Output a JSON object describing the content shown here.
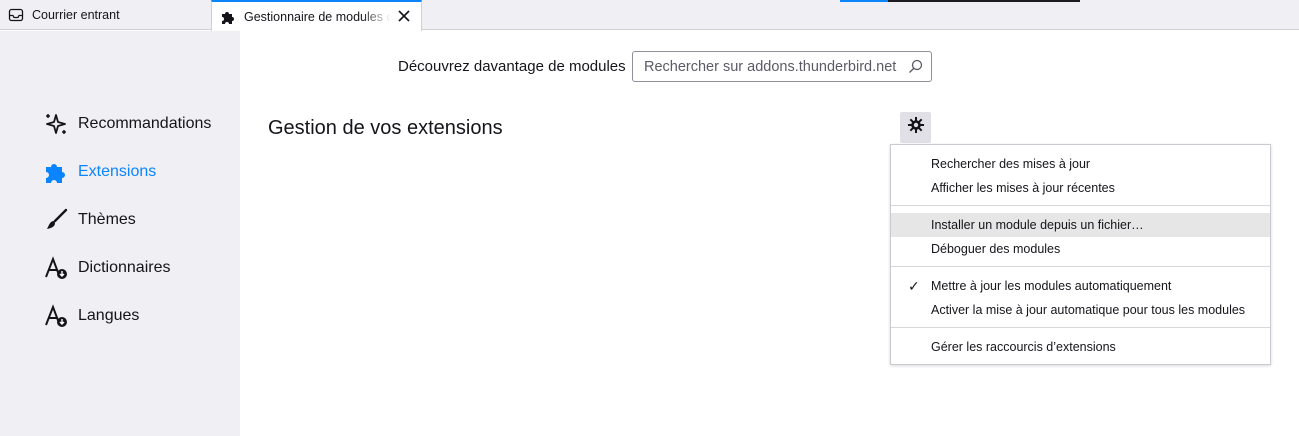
{
  "tabs": [
    {
      "label": "Courrier entrant",
      "icon": "inbox-icon",
      "active": false
    },
    {
      "label": "Gestionnaire de modules complémentaires",
      "icon": "puzzle-icon",
      "active": true
    }
  ],
  "sidebar": {
    "items": [
      {
        "label": "Recommandations",
        "icon": "sparkle-icon",
        "selected": false
      },
      {
        "label": "Extensions",
        "icon": "puzzle-icon",
        "selected": true
      },
      {
        "label": "Thèmes",
        "icon": "brush-icon",
        "selected": false
      },
      {
        "label": "Dictionnaires",
        "icon": "dictionary-icon",
        "selected": false
      },
      {
        "label": "Langues",
        "icon": "language-icon",
        "selected": false
      }
    ]
  },
  "search": {
    "label": "Découvrez davantage de modules",
    "placeholder": "Rechercher sur addons.thunderbird.net",
    "value": ""
  },
  "main": {
    "title": "Gestion de vos extensions"
  },
  "menu": {
    "items": [
      {
        "label": "Rechercher des mises à jour",
        "checked": false,
        "highlighted": false
      },
      {
        "label": "Afficher les mises à jour récentes",
        "checked": false,
        "highlighted": false
      },
      {
        "label": "Installer un module depuis un fichier…",
        "checked": false,
        "highlighted": true
      },
      {
        "label": "Déboguer des modules",
        "checked": false,
        "highlighted": false
      },
      {
        "label": "Mettre à jour les modules automatiquement",
        "checked": true,
        "highlighted": false
      },
      {
        "label": "Activer la mise à jour automatique pour tous les modules",
        "checked": false,
        "highlighted": false
      },
      {
        "label": "Gérer les raccourcis d’extensions",
        "checked": false,
        "highlighted": false
      }
    ],
    "check_glyph": "✓"
  },
  "colors": {
    "accent": "#0a84ff",
    "sidebar_bg": "#f0f0f4",
    "menu_highlight": "#e6e6e6"
  }
}
